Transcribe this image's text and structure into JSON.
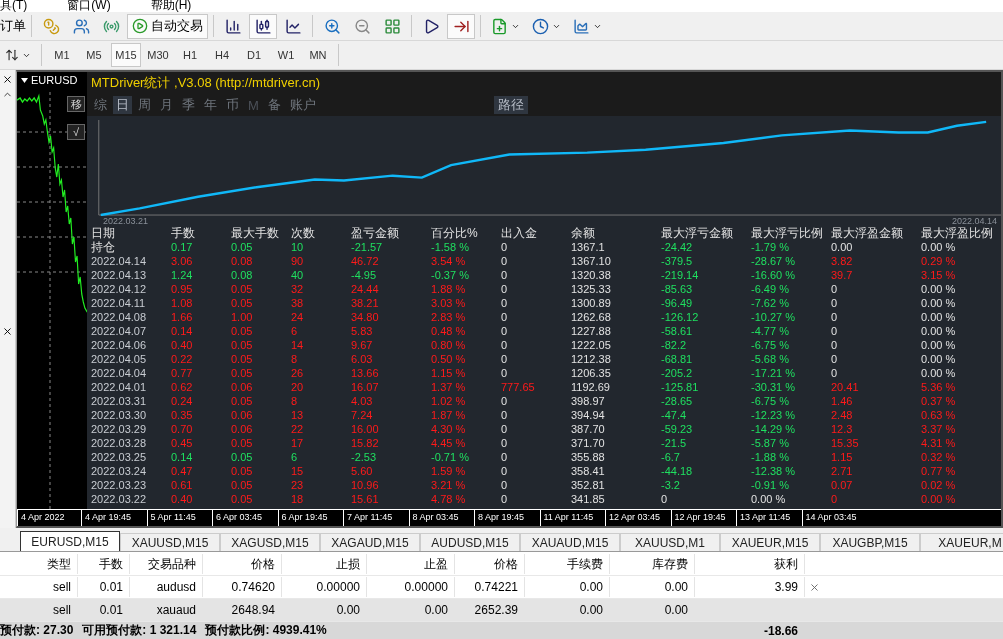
{
  "menu": [
    "具(T)",
    "窗口(W)",
    "帮助(H)"
  ],
  "toolbar": {
    "new_order": "订单",
    "buttons_before": [
      {
        "kind": "gold",
        "pressed": false
      },
      {
        "kind": "people",
        "pressed": false
      },
      {
        "kind": "signal",
        "pressed": false
      }
    ],
    "auto_trading": {
      "label": "自动交易",
      "pressed": true
    },
    "buttons_after": [
      {
        "kind": "bars",
        "pressed": false
      },
      {
        "kind": "candles",
        "pressed": true
      },
      {
        "kind": "line",
        "pressed": false
      },
      {
        "kind": "zoom-in",
        "pressed": false
      },
      {
        "kind": "zoom-out",
        "pressed": false
      },
      {
        "kind": "tile",
        "pressed": false
      },
      {
        "kind": "shift",
        "pressed": false
      },
      {
        "kind": "autoscroll",
        "pressed": true
      },
      {
        "kind": "new-chart",
        "pressed": false
      },
      {
        "kind": "clock",
        "pressed": false
      },
      {
        "kind": "template",
        "pressed": false
      }
    ]
  },
  "timeframes": [
    {
      "label": "M1",
      "selected": false
    },
    {
      "label": "M5",
      "selected": false
    },
    {
      "label": "M15",
      "selected": true
    },
    {
      "label": "M30",
      "selected": false
    },
    {
      "label": "H1",
      "selected": false
    },
    {
      "label": "H4",
      "selected": false
    },
    {
      "label": "D1",
      "selected": false
    },
    {
      "label": "W1",
      "selected": false
    },
    {
      "label": "MN",
      "selected": false
    }
  ],
  "chart": {
    "symbol": "EURUSD",
    "side_buttons": [
      "移",
      "√"
    ],
    "time_axis": [
      "4 Apr 2022",
      "4 Apr 19:45",
      "5 Apr 11:45",
      "6 Apr 03:45",
      "6 Apr 19:45",
      "7 Apr 11:45",
      "8 Apr 03:45",
      "8 Apr 19:45",
      "11 Apr 11:45",
      "12 Apr 03:45",
      "12 Apr 19:45",
      "13 Apr 11:45",
      "14 Apr 03:45"
    ]
  },
  "stats": {
    "title": "MTDriver统计 ,V3.08 (http://mtdriver.cn)",
    "nav": [
      {
        "label": "综",
        "selected": false,
        "disabled": false
      },
      {
        "label": "日",
        "selected": true,
        "disabled": false
      },
      {
        "label": "周",
        "selected": false,
        "disabled": false
      },
      {
        "label": "月",
        "selected": false,
        "disabled": false
      },
      {
        "label": "季",
        "selected": false,
        "disabled": false
      },
      {
        "label": "年",
        "selected": false,
        "disabled": false
      },
      {
        "label": "币",
        "selected": false,
        "disabled": false
      },
      {
        "label": "M",
        "selected": false,
        "disabled": true
      },
      {
        "label": "备",
        "selected": false,
        "disabled": false
      },
      {
        "label": "账户",
        "selected": false,
        "disabled": false
      }
    ],
    "path_button": "路径",
    "start_date": "2022.03.21",
    "end_date": "2022.04.14",
    "columns": [
      "日期",
      "手数",
      "最大手数",
      "次数",
      "盈亏金额",
      "百分比%",
      "出入金",
      "余额",
      "最大浮亏金额",
      "最大浮亏比例",
      "最大浮盈金额",
      "最大浮盈比例"
    ],
    "rows": [
      {
        "date": "持仓",
        "values": [
          "0.17",
          "0.05",
          "10",
          "-21.57",
          "-1.58 %",
          "0",
          "1367.1",
          "-24.42",
          "-1.79 %",
          "0.00",
          "0.00 %"
        ],
        "gain": false,
        "flow_marked": false,
        "float_loss_marked": true,
        "float_profit_marked": false
      },
      {
        "date": "2022.04.14",
        "values": [
          "3.06",
          "0.08",
          "90",
          "46.72",
          "3.54 %",
          "0",
          "1367.10",
          "-379.5",
          "-28.67 %",
          "3.82",
          "0.29 %"
        ],
        "gain": true,
        "flow_marked": false,
        "float_loss_marked": true,
        "float_profit_marked": true
      },
      {
        "date": "2022.04.13",
        "values": [
          "1.24",
          "0.08",
          "40",
          "-4.95",
          "-0.37 %",
          "0",
          "1320.38",
          "-219.14",
          "-16.60 %",
          "39.7",
          "3.15 %"
        ],
        "gain": false,
        "flow_marked": false,
        "float_loss_marked": true,
        "float_profit_marked": true
      },
      {
        "date": "2022.04.12",
        "values": [
          "0.95",
          "0.05",
          "32",
          "24.44",
          "1.88 %",
          "0",
          "1325.33",
          "-85.63",
          "-6.49 %",
          "0",
          "0.00 %"
        ],
        "gain": true,
        "flow_marked": false,
        "float_loss_marked": true,
        "float_profit_marked": false
      },
      {
        "date": "2022.04.11",
        "values": [
          "1.08",
          "0.05",
          "38",
          "38.21",
          "3.03 %",
          "0",
          "1300.89",
          "-96.49",
          "-7.62 %",
          "0",
          "0.00 %"
        ],
        "gain": true,
        "flow_marked": false,
        "float_loss_marked": true,
        "float_profit_marked": false
      },
      {
        "date": "2022.04.08",
        "values": [
          "1.66",
          "1.00",
          "24",
          "34.80",
          "2.83 %",
          "0",
          "1262.68",
          "-126.12",
          "-10.27 %",
          "0",
          "0.00 %"
        ],
        "gain": true,
        "flow_marked": false,
        "float_loss_marked": true,
        "float_profit_marked": false
      },
      {
        "date": "2022.04.07",
        "values": [
          "0.14",
          "0.05",
          "6",
          "5.83",
          "0.48 %",
          "0",
          "1227.88",
          "-58.61",
          "-4.77 %",
          "0",
          "0.00 %"
        ],
        "gain": true,
        "flow_marked": false,
        "float_loss_marked": true,
        "float_profit_marked": false
      },
      {
        "date": "2022.04.06",
        "values": [
          "0.40",
          "0.05",
          "14",
          "9.67",
          "0.80 %",
          "0",
          "1222.05",
          "-82.2",
          "-6.75 %",
          "0",
          "0.00 %"
        ],
        "gain": true,
        "flow_marked": false,
        "float_loss_marked": true,
        "float_profit_marked": false
      },
      {
        "date": "2022.04.05",
        "values": [
          "0.22",
          "0.05",
          "8",
          "6.03",
          "0.50 %",
          "0",
          "1212.38",
          "-68.81",
          "-5.68 %",
          "0",
          "0.00 %"
        ],
        "gain": true,
        "flow_marked": false,
        "float_loss_marked": true,
        "float_profit_marked": false
      },
      {
        "date": "2022.04.04",
        "values": [
          "0.77",
          "0.05",
          "26",
          "13.66",
          "1.15 %",
          "0",
          "1206.35",
          "-205.2",
          "-17.21 %",
          "0",
          "0.00 %"
        ],
        "gain": true,
        "flow_marked": false,
        "float_loss_marked": true,
        "float_profit_marked": false
      },
      {
        "date": "2022.04.01",
        "values": [
          "0.62",
          "0.06",
          "20",
          "16.07",
          "1.37 %",
          "777.65",
          "1192.69",
          "-125.81",
          "-30.31 %",
          "20.41",
          "5.36 %"
        ],
        "gain": true,
        "flow_marked": true,
        "float_loss_marked": true,
        "float_profit_marked": true
      },
      {
        "date": "2022.03.31",
        "values": [
          "0.24",
          "0.05",
          "8",
          "4.03",
          "1.02 %",
          "0",
          "398.97",
          "-28.65",
          "-6.75 %",
          "1.46",
          "0.37 %"
        ],
        "gain": true,
        "flow_marked": false,
        "float_loss_marked": true,
        "float_profit_marked": true
      },
      {
        "date": "2022.03.30",
        "values": [
          "0.35",
          "0.06",
          "13",
          "7.24",
          "1.87 %",
          "0",
          "394.94",
          "-47.4",
          "-12.23 %",
          "2.48",
          "0.63 %"
        ],
        "gain": true,
        "flow_marked": false,
        "float_loss_marked": true,
        "float_profit_marked": true
      },
      {
        "date": "2022.03.29",
        "values": [
          "0.70",
          "0.06",
          "22",
          "16.00",
          "4.30 %",
          "0",
          "387.70",
          "-59.23",
          "-14.29 %",
          "12.3",
          "3.37 %"
        ],
        "gain": true,
        "flow_marked": false,
        "float_loss_marked": true,
        "float_profit_marked": true
      },
      {
        "date": "2022.03.28",
        "values": [
          "0.45",
          "0.05",
          "17",
          "15.82",
          "4.45 %",
          "0",
          "371.70",
          "-21.5",
          "-5.87 %",
          "15.35",
          "4.31 %"
        ],
        "gain": true,
        "flow_marked": false,
        "float_loss_marked": true,
        "float_profit_marked": true
      },
      {
        "date": "2022.03.25",
        "values": [
          "0.14",
          "0.05",
          "6",
          "-2.53",
          "-0.71 %",
          "0",
          "355.88",
          "-6.7",
          "-1.88 %",
          "1.15",
          "0.32 %"
        ],
        "gain": false,
        "flow_marked": false,
        "float_loss_marked": true,
        "float_profit_marked": true
      },
      {
        "date": "2022.03.24",
        "values": [
          "0.47",
          "0.05",
          "15",
          "5.60",
          "1.59 %",
          "0",
          "358.41",
          "-44.18",
          "-12.38 %",
          "2.71",
          "0.77 %"
        ],
        "gain": true,
        "flow_marked": false,
        "float_loss_marked": true,
        "float_profit_marked": true
      },
      {
        "date": "2022.03.23",
        "values": [
          "0.61",
          "0.05",
          "23",
          "10.96",
          "3.21 %",
          "0",
          "352.81",
          "-3.2",
          "-0.91 %",
          "0.07",
          "0.02 %"
        ],
        "gain": true,
        "flow_marked": false,
        "float_loss_marked": true,
        "float_profit_marked": true
      },
      {
        "date": "2022.03.22",
        "values": [
          "0.40",
          "0.05",
          "18",
          "15.61",
          "4.78 %",
          "0",
          "341.85",
          "0",
          "0.00 %",
          "0",
          "0.00 %"
        ],
        "gain": true,
        "flow_marked": false,
        "float_loss_marked": false,
        "float_profit_marked": true
      }
    ]
  },
  "chart_tabs": [
    {
      "label": "EURUSD,M15",
      "selected": true
    },
    {
      "label": "XAUUSD,M15",
      "selected": false
    },
    {
      "label": "XAGUSD,M15",
      "selected": false
    },
    {
      "label": "XAGAUD,M15",
      "selected": false
    },
    {
      "label": "AUDUSD,M15",
      "selected": false
    },
    {
      "label": "XAUAUD,M15",
      "selected": false
    },
    {
      "label": "XAUUSD,M1",
      "selected": false
    },
    {
      "label": "XAUEUR,M15",
      "selected": false
    },
    {
      "label": "XAUGBP,M15",
      "selected": false
    },
    {
      "label": "XAUEUR,M",
      "selected": false
    }
  ],
  "trades": {
    "columns": [
      "类型",
      "手数",
      "交易品种",
      "价格",
      "止损",
      "止盈",
      "价格",
      "手续费",
      "库存费",
      "获利"
    ],
    "rows": [
      {
        "values": [
          "sell",
          "0.01",
          "audusd",
          "0.74620",
          "0.00000",
          "0.00000",
          "0.74221",
          "0.00",
          "0.00",
          "3.99"
        ],
        "selected": false,
        "closable": true
      },
      {
        "values": [
          "sell",
          "0.01",
          "xauaud",
          "2648.94",
          "0.00",
          "0.00",
          "2652.39",
          "0.00",
          "0.00"
        ],
        "selected": true,
        "closable": false
      }
    ],
    "footer": {
      "margin": "预付款: 27.30",
      "free_margin": "可用预付款: 1 321.14",
      "margin_level": "预付款比例: 4939.41%",
      "profit": "-18.66"
    }
  }
}
